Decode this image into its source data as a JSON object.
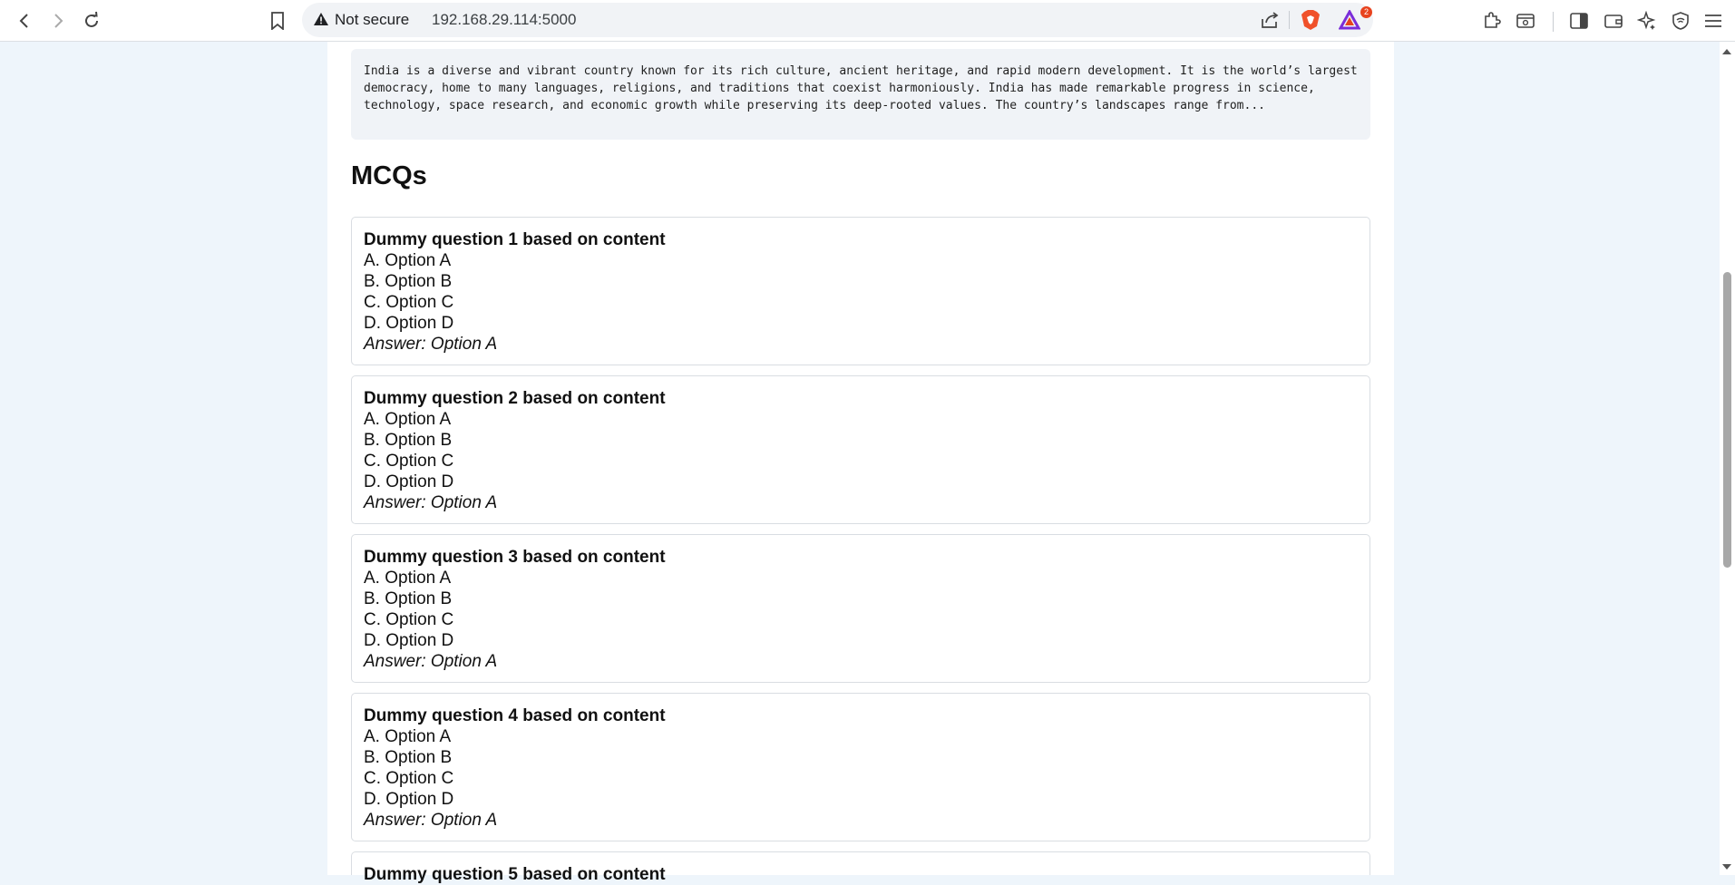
{
  "browser": {
    "security_label": "Not secure",
    "url": "192.168.29.114:5000",
    "rewards_badge": "2",
    "accent_brave": "#f0512a",
    "accent_rewards": "#7a2dd9"
  },
  "summary": {
    "text": "India is a diverse and vibrant country known for its rich culture, ancient heritage, and rapid modern development. It is the world’s largest democracy, home to many languages, religions, and traditions that coexist harmoniously. India has made remarkable progress in science, technology, space research, and economic growth while preserving its deep-rooted values. The country’s landscapes range from..."
  },
  "mcqs": {
    "heading": "MCQs",
    "items": [
      {
        "question": "Dummy question 1 based on content",
        "a": "A. Option A",
        "b": "B. Option B",
        "c": "C. Option C",
        "d": "D. Option D",
        "answer": "Answer: Option A"
      },
      {
        "question": "Dummy question 2 based on content",
        "a": "A. Option A",
        "b": "B. Option B",
        "c": "C. Option C",
        "d": "D. Option D",
        "answer": "Answer: Option A"
      },
      {
        "question": "Dummy question 3 based on content",
        "a": "A. Option A",
        "b": "B. Option B",
        "c": "C. Option C",
        "d": "D. Option D",
        "answer": "Answer: Option A"
      },
      {
        "question": "Dummy question 4 based on content",
        "a": "A. Option A",
        "b": "B. Option B",
        "c": "C. Option C",
        "d": "D. Option D",
        "answer": "Answer: Option A"
      },
      {
        "question": "Dummy question 5 based on content"
      }
    ]
  }
}
